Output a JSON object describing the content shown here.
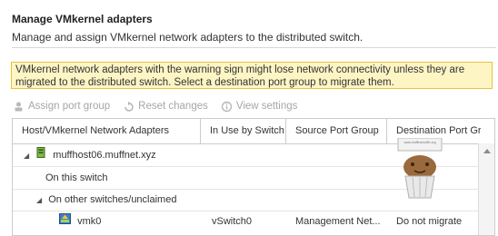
{
  "header": {
    "title": "Manage VMkernel adapters",
    "subtitle": "Manage and assign VMkernel network adapters to the distributed switch."
  },
  "warning": {
    "text": "VMkernel network adapters with the warning sign might lose network connectivity unless they are migrated to the distributed switch. Select a destination port group to migrate them."
  },
  "toolbar": {
    "assign_label": "Assign port group",
    "reset_label": "Reset changes",
    "view_label": "View settings"
  },
  "table": {
    "columns": [
      "Host/VMkernel Network Adapters",
      "In Use by Switch",
      "Source Port Group",
      "Destination Port Gr..."
    ],
    "rows": {
      "host": {
        "name": "muffhost06.muffnet.xyz"
      },
      "on_this_switch": {
        "label": "On this switch"
      },
      "other": {
        "label": "On other switches/unclaimed"
      },
      "vmk": {
        "name": "vmk0",
        "in_use": "vSwitch0",
        "source": "Management Net...",
        "destination": "Do not migrate"
      }
    }
  },
  "watermark": {
    "text": "www.muffinsmuffin.org"
  },
  "colors": {
    "warning_bg": "#fef5c5",
    "warning_border": "#e8c43a",
    "disabled_text": "#a6a6a6"
  }
}
